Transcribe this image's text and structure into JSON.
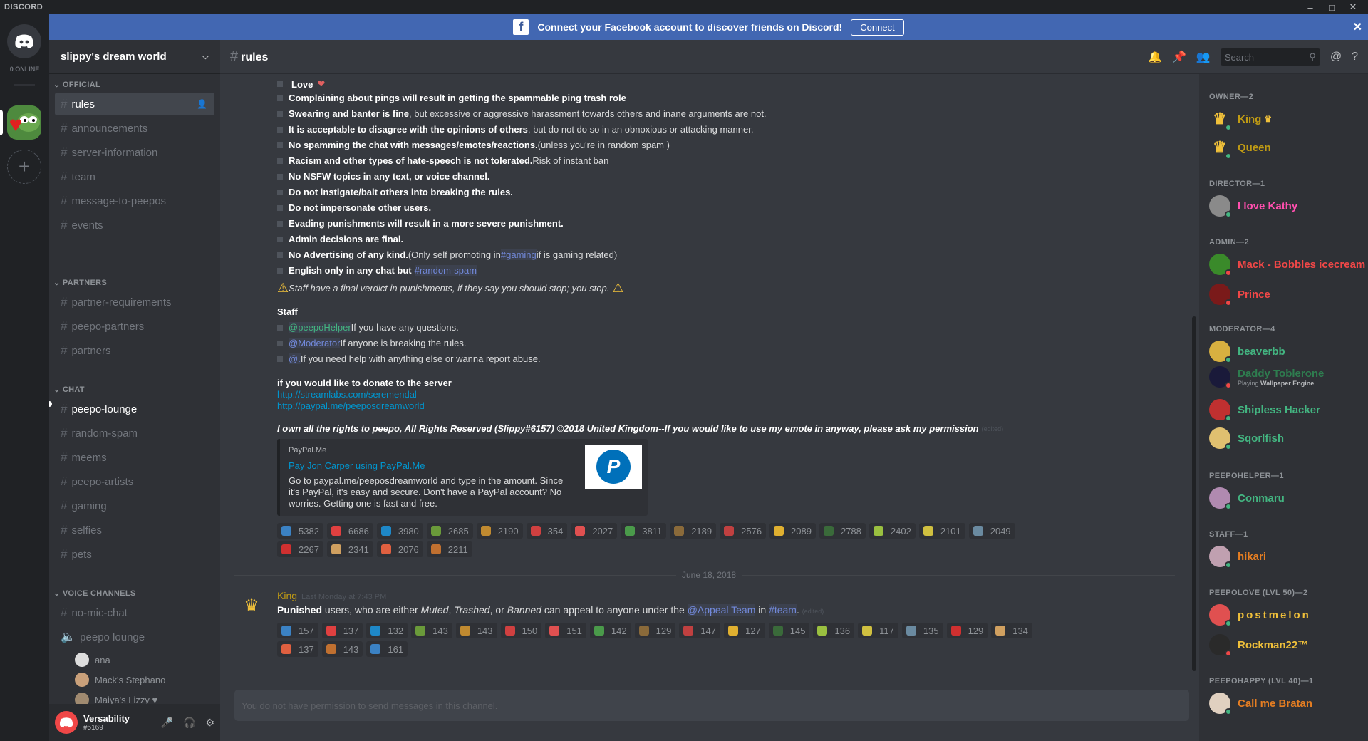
{
  "app": {
    "name": "DISCORD",
    "online_count": "0 ONLINE"
  },
  "banner": {
    "text": "Connect your Facebook account to discover friends on Discord!",
    "button": "Connect"
  },
  "server": {
    "name": "slippy's dream world"
  },
  "channel": {
    "name": "rules"
  },
  "search": {
    "placeholder": "Search"
  },
  "categories": {
    "official": "OFFICIAL",
    "partners": "PARTNERS",
    "chat": "CHAT",
    "voice": "VOICE CHANNELS"
  },
  "channels": {
    "official": [
      "rules",
      "announcements",
      "server-information",
      "team",
      "message-to-peepos",
      "events"
    ],
    "partners": [
      "partner-requirements",
      "peepo-partners",
      "partners"
    ],
    "chat": [
      "peepo-lounge",
      "random-spam",
      "meems",
      "peepo-artists",
      "gaming",
      "selfies",
      "pets"
    ],
    "voice": [
      "no-mic-chat",
      "peepo lounge"
    ]
  },
  "voice_users": [
    "ana",
    "Mack's Stephano",
    "Maiya's Lizzy ♥"
  ],
  "user": {
    "name": "Versability",
    "tag": "#5169"
  },
  "rules": {
    "love": "Love",
    "r1b": "Complaining about pings will result in getting the spammable ping trash role",
    "r2b": "Swearing and banter is fine",
    "r2t": ", but excessive or aggressive harassment towards others and inane arguments are not.",
    "r3b": "It is acceptable to disagree with the opinions of others",
    "r3t": ", but do not do so in an obnoxious or attacking manner.",
    "r4b": "No spamming the chat with messages/emotes/reactions.",
    "r4t": " (unless you're in random spam )",
    "r5b": "Racism and other types of hate-speech is not tolerated.",
    "r5t": " Risk of instant ban",
    "r6b": "No NSFW topics in any text, or voice channel.",
    "r7b": "Do not instigate/bait others into breaking the rules.",
    "r8b": "Do not impersonate other users.",
    "r9b": "Evading punishments will result in a more severe punishment.",
    "r10b": "Admin decisions are final.",
    "r11b": "No Advertising of any kind.",
    "r11t1": " (Only self promoting in ",
    "r11m": "#gaming",
    "r11t2": " if is gaming related)",
    "r12b": "English only in any chat but ",
    "r12m": "#random-spam",
    "warn": "Staff have a final verdict in punishments, if they say you should stop; you stop.",
    "staff": "Staff",
    "s1m": "@peepoHelper",
    "s1t": " If you have any questions.",
    "s2m": "@Moderator",
    "s2t": " If anyone is breaking the rules.",
    "s3m": "@.",
    "s3t": " If you need help with anything else or wanna report abuse.",
    "donate": "if you would like to donate to the server",
    "link1": "http://streamlabs.com/seremendal",
    "link2": "http://paypal.me/peeposdreamworld",
    "rights": "I own all the rights to peepo, All Rights Reserved (Slippy#6157) ©2018 United Kingdom--If you would like to use my emote in anyway, please ask my permission",
    "edited": "(edited)"
  },
  "embed": {
    "provider": "PayPal.Me",
    "title": "Pay Jon Carper using PayPal.Me",
    "desc": "Go to paypal.me/peeposdreamworld and type in the amount. Since it's PayPal, it's easy and secure. Don't have a PayPal account? No worries. Getting one is fast and free."
  },
  "reactions1": [
    "5382",
    "6686",
    "3980",
    "2685",
    "2190",
    "354",
    "2027",
    "3811",
    "2189",
    "2576",
    "2089",
    "2788",
    "2402",
    "2101",
    "2049",
    "2267",
    "2341",
    "2076",
    "2211"
  ],
  "date_divider": "June 18, 2018",
  "msg2": {
    "author": "King",
    "time": "Last Monday at 7:43 PM",
    "b1": "Punished",
    "t1": " users, who are either ",
    "i1": "Muted",
    "t2": ", ",
    "i2": "Trashed",
    "t3": ", or ",
    "i3": "Banned",
    "t4": " can appeal to anyone under the ",
    "m1": "@Appeal Team",
    "t5": " in ",
    "m2": "#team",
    "t6": ".",
    "edited": "(edited)"
  },
  "reactions2": [
    "157",
    "137",
    "132",
    "143",
    "143",
    "150",
    "151",
    "142",
    "129",
    "147",
    "127",
    "145",
    "136",
    "117",
    "135",
    "129",
    "134",
    "137",
    "143",
    "161"
  ],
  "input_placeholder": "You do not have permission to send messages in this channel.",
  "members": {
    "owner": "OWNER—2",
    "director": "DIRECTOR—1",
    "admin": "ADMIN—2",
    "moderator": "MODERATOR—4",
    "peepohelper": "PEEPOHELPER—1",
    "staff": "STAFF—1",
    "peepolove": "PEEPOLOVE (LVL 50)—2",
    "peepohappy": "PEEPOHAPPY (LVL 40)—1",
    "king": "King",
    "queen": "Queen",
    "kathy": "I love Kathy",
    "mack": "Mack - Bobbles icecream",
    "prince": "Prince",
    "beaverbb": "beaverbb",
    "daddy": "Daddy Toblerone",
    "daddy_playing": "Playing",
    "daddy_game": "Wallpaper Engine",
    "shipless": "Shipless Hacker",
    "sqorl": "Sqorlfish",
    "conmaru": "Conmaru",
    "hikari": "hikari",
    "postmelon": "postmelon",
    "rockman": "Rockman22™",
    "bratan": "Call me Bratan"
  }
}
